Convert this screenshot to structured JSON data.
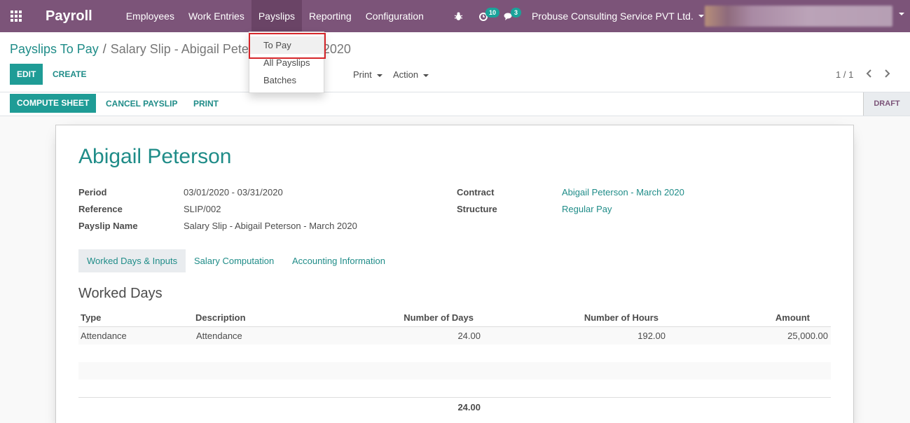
{
  "navbar": {
    "app_name": "Payroll",
    "menu": [
      "Employees",
      "Work Entries",
      "Payslips",
      "Reporting",
      "Configuration"
    ],
    "activity_count": "10",
    "message_count": "3",
    "company": "Probuse Consulting Service PVT Ltd."
  },
  "payslips_menu": {
    "items": [
      "To Pay",
      "All Payslips",
      "Batches"
    ]
  },
  "breadcrumb": {
    "parent": "Payslips To Pay",
    "separator": "/",
    "current": "Salary Slip - Abigail Peterson - March 2020"
  },
  "buttons": {
    "edit": "EDIT",
    "create": "CREATE",
    "print_dd": "Print",
    "action_dd": "Action",
    "compute": "COMPUTE SHEET",
    "cancel": "CANCEL PAYSLIP",
    "print": "PRINT"
  },
  "pager": "1 / 1",
  "status": "DRAFT",
  "form": {
    "employee": "Abigail Peterson",
    "period_label": "Period",
    "period": "03/01/2020 - 03/31/2020",
    "reference_label": "Reference",
    "reference": "SLIP/002",
    "payslip_name_label": "Payslip Name",
    "payslip_name": "Salary Slip - Abigail Peterson - March 2020",
    "contract_label": "Contract",
    "contract": "Abigail Peterson - March 2020",
    "structure_label": "Structure",
    "structure": "Regular Pay"
  },
  "tabs": [
    "Worked Days & Inputs",
    "Salary Computation",
    "Accounting Information"
  ],
  "worked_days": {
    "title": "Worked Days",
    "columns": [
      "Type",
      "Description",
      "Number of Days",
      "Number of Hours",
      "Amount"
    ],
    "rows": [
      {
        "type": "Attendance",
        "description": "Attendance",
        "days": "24.00",
        "hours": "192.00",
        "amount": "25,000.00"
      }
    ],
    "total_days": "24.00"
  }
}
